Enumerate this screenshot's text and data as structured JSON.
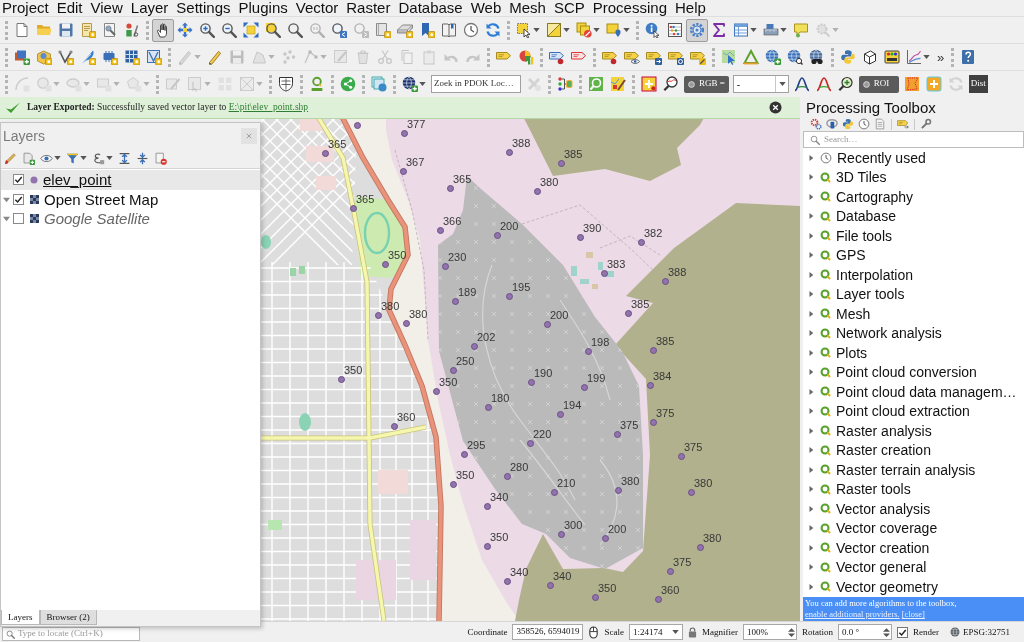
{
  "menu": [
    "Project",
    "Edit",
    "View",
    "Layer",
    "Settings",
    "Plugins",
    "Vector",
    "Raster",
    "Database",
    "Web",
    "Mesh",
    "SCP",
    "Processing",
    "Help"
  ],
  "toolbar_rows": [
    [
      [
        {
          "kind": "new",
          "disabled": false,
          "on": false,
          "dropdown": false
        },
        {
          "kind": "open",
          "disabled": false,
          "on": false,
          "dropdown": false
        },
        {
          "kind": "save",
          "disabled": false,
          "on": false,
          "dropdown": false
        },
        {
          "kind": "new-layout",
          "disabled": false,
          "on": false,
          "dropdown": false
        },
        {
          "kind": "layout-manager",
          "disabled": false,
          "on": false,
          "dropdown": false
        },
        {
          "kind": "style-manager",
          "disabled": false,
          "on": false,
          "dropdown": false
        }
      ],
      [
        {
          "kind": "pan",
          "disabled": false,
          "on": true,
          "dropdown": false
        },
        {
          "kind": "pan-selection",
          "disabled": false,
          "on": false,
          "dropdown": false
        },
        {
          "kind": "zoom-in",
          "disabled": false,
          "on": false,
          "dropdown": false
        },
        {
          "kind": "zoom-out",
          "disabled": false,
          "on": false,
          "dropdown": false
        },
        {
          "kind": "zoom-full",
          "disabled": false,
          "on": false,
          "dropdown": false
        },
        {
          "kind": "zoom-selection",
          "disabled": false,
          "on": false,
          "dropdown": false
        },
        {
          "kind": "zoom-layer",
          "disabled": false,
          "on": false,
          "dropdown": false
        },
        {
          "kind": "zoom-native",
          "disabled": true,
          "on": false,
          "dropdown": false
        },
        {
          "kind": "zoom-last",
          "disabled": false,
          "on": false,
          "dropdown": false
        },
        {
          "kind": "zoom-next",
          "disabled": true,
          "on": false,
          "dropdown": false
        },
        {
          "kind": "new-map-view",
          "disabled": false,
          "on": false,
          "dropdown": false
        },
        {
          "kind": "new-3d-view",
          "disabled": false,
          "on": false,
          "dropdown": false
        },
        {
          "kind": "new-bookmark",
          "disabled": false,
          "on": false,
          "dropdown": false
        },
        {
          "kind": "bookmarks",
          "disabled": false,
          "on": false,
          "dropdown": false
        },
        {
          "kind": "temporal",
          "disabled": false,
          "on": false,
          "dropdown": false
        },
        {
          "kind": "refresh",
          "disabled": false,
          "on": false,
          "dropdown": false
        }
      ],
      [
        {
          "kind": "select",
          "disabled": false,
          "on": false,
          "dropdown": true
        },
        {
          "kind": "select-polygon",
          "disabled": false,
          "on": false,
          "dropdown": true
        },
        {
          "kind": "deselect",
          "disabled": false,
          "on": false,
          "dropdown": true
        },
        {
          "kind": "select-location",
          "disabled": false,
          "on": false,
          "dropdown": true
        }
      ],
      [
        {
          "kind": "identify",
          "disabled": false,
          "on": false,
          "dropdown": false
        },
        {
          "kind": "field-calculator",
          "disabled": false,
          "on": false,
          "dropdown": false
        },
        {
          "kind": "toolbox",
          "disabled": false,
          "on": true,
          "dropdown": false
        },
        {
          "kind": "statistics",
          "disabled": false,
          "on": false,
          "dropdown": false
        },
        {
          "kind": "attribute-table",
          "disabled": false,
          "on": false,
          "dropdown": true
        },
        {
          "kind": "measure",
          "disabled": false,
          "on": false,
          "dropdown": true
        },
        {
          "kind": "map-tips",
          "disabled": false,
          "on": false,
          "dropdown": false
        },
        {
          "kind": "actions",
          "disabled": true,
          "on": false,
          "dropdown": true
        }
      ]
    ],
    [
      [
        {
          "kind": "data-source",
          "disabled": false,
          "on": false,
          "dropdown": false
        },
        {
          "kind": "new-geopackage",
          "disabled": false,
          "on": false,
          "dropdown": false
        },
        {
          "kind": "new-shapefile",
          "disabled": false,
          "on": false,
          "dropdown": false
        },
        {
          "kind": "new-spatialite",
          "disabled": false,
          "on": false,
          "dropdown": false
        },
        {
          "kind": "new-scratch",
          "disabled": false,
          "on": false,
          "dropdown": false
        },
        {
          "kind": "new-virtual",
          "disabled": false,
          "on": false,
          "dropdown": false
        },
        {
          "kind": "new-mesh",
          "disabled": false,
          "on": false,
          "dropdown": false
        }
      ],
      [
        {
          "kind": "current-edits",
          "disabled": true,
          "on": false,
          "dropdown": true
        },
        {
          "kind": "toggle-editing",
          "disabled": false,
          "on": false,
          "dropdown": false
        },
        {
          "kind": "save-edits",
          "disabled": true,
          "on": false,
          "dropdown": false
        },
        {
          "kind": "add-feature",
          "disabled": true,
          "on": false,
          "dropdown": true
        },
        {
          "kind": "add-points",
          "disabled": true,
          "on": false,
          "dropdown": false
        },
        {
          "kind": "vertex-tool",
          "disabled": true,
          "on": false,
          "dropdown": true
        },
        {
          "kind": "modify-attributes",
          "disabled": true,
          "on": false,
          "dropdown": false
        },
        {
          "kind": "delete",
          "disabled": true,
          "on": false,
          "dropdown": false
        },
        {
          "kind": "cut",
          "disabled": true,
          "on": false,
          "dropdown": false
        },
        {
          "kind": "copy",
          "disabled": true,
          "on": false,
          "dropdown": false
        },
        {
          "kind": "paste",
          "disabled": true,
          "on": false,
          "dropdown": false
        },
        {
          "kind": "undo",
          "disabled": true,
          "on": false,
          "dropdown": false
        },
        {
          "kind": "redo",
          "disabled": true,
          "on": false,
          "dropdown": false
        }
      ],
      [
        {
          "kind": "labeling",
          "disabled": false,
          "on": false,
          "dropdown": false
        },
        {
          "kind": "diagram",
          "disabled": false,
          "on": false,
          "dropdown": false
        }
      ],
      [
        {
          "kind": "pinned-labels",
          "disabled": false,
          "on": false,
          "dropdown": false
        },
        {
          "kind": "unplaced-labels",
          "disabled": false,
          "on": false,
          "dropdown": false
        }
      ],
      [
        {
          "kind": "pin-label",
          "disabled": false,
          "on": false,
          "dropdown": false
        },
        {
          "kind": "show-label",
          "disabled": false,
          "on": false,
          "dropdown": false
        },
        {
          "kind": "move-label",
          "disabled": false,
          "on": false,
          "dropdown": false
        },
        {
          "kind": "rotate-label",
          "disabled": false,
          "on": false,
          "dropdown": false
        },
        {
          "kind": "change-label",
          "disabled": false,
          "on": false,
          "dropdown": false
        }
      ],
      [
        {
          "kind": "map-select",
          "disabled": false,
          "on": false,
          "dropdown": false
        },
        {
          "kind": "triangle",
          "disabled": false,
          "on": false,
          "dropdown": false
        },
        {
          "kind": "globe-add",
          "disabled": false,
          "on": false,
          "dropdown": false
        },
        {
          "kind": "globe-search",
          "disabled": false,
          "on": false,
          "dropdown": false
        },
        {
          "kind": "globe-binoculars",
          "disabled": false,
          "on": false,
          "dropdown": false
        }
      ],
      [
        {
          "kind": "python",
          "disabled": false,
          "on": false,
          "dropdown": false
        },
        {
          "kind": "cube",
          "disabled": false,
          "on": false,
          "dropdown": false
        },
        {
          "kind": "scp-dock",
          "disabled": false,
          "on": false,
          "dropdown": false
        },
        {
          "kind": "chart",
          "disabled": false,
          "on": false,
          "dropdown": true
        },
        {
          "kind": "more",
          "label": "»",
          "disabled": false,
          "on": false,
          "dropdown": false
        }
      ],
      [
        {
          "kind": "help",
          "disabled": false,
          "on": false,
          "dropdown": false
        }
      ]
    ],
    [
      [
        {
          "kind": "arc",
          "disabled": true,
          "on": false,
          "dropdown": false
        },
        {
          "kind": "circle",
          "disabled": true,
          "on": false,
          "dropdown": true
        },
        {
          "kind": "ellipse",
          "disabled": true,
          "on": false,
          "dropdown": true
        },
        {
          "kind": "rectangle",
          "disabled": true,
          "on": false,
          "dropdown": true
        },
        {
          "kind": "polygon",
          "disabled": true,
          "on": false,
          "dropdown": true
        }
      ],
      [
        {
          "kind": "square-pencil",
          "disabled": true,
          "on": false,
          "dropdown": false
        },
        {
          "kind": "map-cursor",
          "disabled": true,
          "on": false,
          "dropdown": true
        },
        {
          "kind": "letter-grid",
          "disabled": true,
          "on": false,
          "dropdown": false
        },
        {
          "kind": "cross-box",
          "disabled": true,
          "on": false,
          "dropdown": true
        }
      ],
      [
        {
          "kind": "crest",
          "disabled": false,
          "on": false,
          "dropdown": false
        }
      ],
      [
        {
          "kind": "hub",
          "disabled": false,
          "on": false,
          "dropdown": false
        }
      ],
      [
        {
          "kind": "share",
          "disabled": false,
          "on": false,
          "dropdown": false
        }
      ],
      [
        {
          "kind": "layers-globe",
          "disabled": false,
          "on": false,
          "dropdown": false
        }
      ],
      [
        {
          "kind": "dark-globe",
          "disabled": false,
          "on": false,
          "dropdown": true
        },
        {
          "kind": "search",
          "placeholder": "Zoek in PDOK Loc…",
          "disabled": false,
          "on": false,
          "dropdown": false
        },
        {
          "kind": "clear",
          "disabled": true,
          "on": false,
          "dropdown": false
        }
      ],
      [
        {
          "kind": "tree",
          "disabled": false,
          "on": false,
          "dropdown": false
        }
      ],
      [
        {
          "kind": "green-search",
          "disabled": false,
          "on": false,
          "dropdown": false
        },
        {
          "kind": "map-pencil",
          "disabled": false,
          "on": false,
          "dropdown": false
        }
      ],
      [
        {
          "kind": "band-set",
          "disabled": false,
          "on": false,
          "dropdown": false
        },
        {
          "kind": "spectral-zoom",
          "disabled": false,
          "on": false,
          "dropdown": false
        },
        {
          "kind": "pill",
          "label": "RGB =",
          "disabled": false,
          "on": false,
          "dropdown": false
        },
        {
          "kind": "combo",
          "value": "-",
          "disabled": false,
          "on": false,
          "dropdown": true
        },
        {
          "kind": "curve-blue",
          "disabled": false,
          "on": false,
          "dropdown": false
        },
        {
          "kind": "curve-red",
          "disabled": false,
          "on": false,
          "dropdown": false
        },
        {
          "kind": "zoom-plus",
          "disabled": false,
          "on": false,
          "dropdown": false
        },
        {
          "kind": "pill",
          "label": "ROI",
          "disabled": false,
          "on": false,
          "dropdown": false
        },
        {
          "kind": "roi-polygon",
          "disabled": false,
          "on": false,
          "dropdown": false
        },
        {
          "kind": "plus",
          "disabled": false,
          "on": false,
          "dropdown": false
        },
        {
          "kind": "reload",
          "disabled": true,
          "on": false,
          "dropdown": false
        },
        {
          "kind": "text",
          "label": "Dist",
          "disabled": false,
          "on": false,
          "dropdown": false
        }
      ]
    ]
  ],
  "message_bar": {
    "text": "**Layer Exported:** Successfully saved vector layer to",
    "link": "E:\\pit\\elev_point.shp"
  },
  "layers_panel": {
    "title": "Layers",
    "layers": [
      {
        "kind": "vector",
        "name": "elev_point",
        "checked": true,
        "selected": true
      },
      {
        "kind": "raster",
        "name": "Open Street Map",
        "checked": true,
        "selected": false,
        "expanded": true
      },
      {
        "kind": "raster",
        "name": "Google Satellite",
        "checked": false,
        "selected": false,
        "expanded": true
      }
    ],
    "tabs": [
      {
        "label": "Layers",
        "selected": true
      },
      {
        "label": "Browser (2)",
        "selected": false
      }
    ]
  },
  "map": {
    "points": [
      {
        "label": "377"
      },
      {
        "label": "365"
      },
      {
        "label": "388"
      },
      {
        "label": "385"
      },
      {
        "label": "367"
      },
      {
        "label": "365"
      },
      {
        "label": "380"
      },
      {
        "label": "365"
      },
      {
        "label": "366"
      },
      {
        "label": "200"
      },
      {
        "label": "390"
      },
      {
        "label": "382"
      },
      {
        "label": "350"
      },
      {
        "label": "230"
      },
      {
        "label": "383"
      },
      {
        "label": "388"
      },
      {
        "label": "189"
      },
      {
        "label": "195"
      },
      {
        "label": "380"
      },
      {
        "label": "385"
      },
      {
        "label": "380"
      },
      {
        "label": "200"
      },
      {
        "label": "202"
      },
      {
        "label": "198"
      },
      {
        "label": "385"
      },
      {
        "label": "250"
      },
      {
        "label": "350"
      },
      {
        "label": "350"
      },
      {
        "label": "190"
      },
      {
        "label": "199"
      },
      {
        "label": "384"
      },
      {
        "label": "180"
      },
      {
        "label": "194"
      },
      {
        "label": "360"
      },
      {
        "label": "375"
      },
      {
        "label": "375"
      },
      {
        "label": "220"
      },
      {
        "label": "295"
      },
      {
        "label": "375"
      },
      {
        "label": "280"
      },
      {
        "label": "350"
      },
      {
        "label": "210"
      },
      {
        "label": "380"
      },
      {
        "label": "380"
      },
      {
        "label": "340"
      },
      {
        "label": "300"
      },
      {
        "label": "200"
      },
      {
        "label": "350"
      },
      {
        "label": "380"
      },
      {
        "label": "375"
      },
      {
        "label": "340"
      },
      {
        "label": "340"
      },
      {
        "label": "350"
      },
      {
        "label": "360"
      }
    ]
  },
  "toolbox": {
    "title": "Processing Toolbox",
    "search": {
      "placeholder": "Search…"
    },
    "items": [
      {
        "kind": "recent",
        "label": "Recently used",
        "expanded": false
      },
      {
        "kind": "provider",
        "label": "3D Tiles",
        "expanded": false
      },
      {
        "kind": "provider",
        "label": "Cartography",
        "expanded": false
      },
      {
        "kind": "provider",
        "label": "Database",
        "expanded": false
      },
      {
        "kind": "provider",
        "label": "File tools",
        "expanded": false
      },
      {
        "kind": "provider",
        "label": "GPS",
        "expanded": false
      },
      {
        "kind": "provider",
        "label": "Interpolation",
        "expanded": false
      },
      {
        "kind": "provider",
        "label": "Layer tools",
        "expanded": false
      },
      {
        "kind": "provider",
        "label": "Mesh",
        "expanded": false
      },
      {
        "kind": "provider",
        "label": "Network analysis",
        "expanded": false
      },
      {
        "kind": "provider",
        "label": "Plots",
        "expanded": false
      },
      {
        "kind": "provider",
        "label": "Point cloud conversion",
        "expanded": false
      },
      {
        "kind": "provider",
        "label": "Point cloud data managem…",
        "expanded": false
      },
      {
        "kind": "provider",
        "label": "Point cloud extraction",
        "expanded": false
      },
      {
        "kind": "provider",
        "label": "Raster analysis",
        "expanded": false
      },
      {
        "kind": "provider",
        "label": "Raster creation",
        "expanded": false
      },
      {
        "kind": "provider",
        "label": "Raster terrain analysis",
        "expanded": false
      },
      {
        "kind": "provider",
        "label": "Raster tools",
        "expanded": false
      },
      {
        "kind": "provider",
        "label": "Vector analysis",
        "expanded": false
      },
      {
        "kind": "provider",
        "label": "Vector coverage",
        "expanded": false
      },
      {
        "kind": "provider",
        "label": "Vector creation",
        "expanded": false
      },
      {
        "kind": "provider",
        "label": "Vector general",
        "expanded": false
      },
      {
        "kind": "provider",
        "label": "Vector geometry",
        "expanded": false
      }
    ],
    "notice": {
      "text": "You can add more algorithms to the toolbox,",
      "link": "enable additional providers.",
      "close": "[close]"
    }
  },
  "status_bar": {
    "locator": {
      "placeholder": "Type to locate (Ctrl+K)"
    },
    "coordinate": {
      "label": "Coordinate",
      "value": "358526, 6594019"
    },
    "scale": {
      "label": "Scale",
      "value": "1:24174"
    },
    "magnifier": {
      "label": "Magnifier",
      "value": "100%"
    },
    "rotation": {
      "label": "Rotation",
      "value": "0.0 °"
    },
    "render": {
      "label": "Render",
      "checked": true
    },
    "crs": "EPSG:32751"
  }
}
